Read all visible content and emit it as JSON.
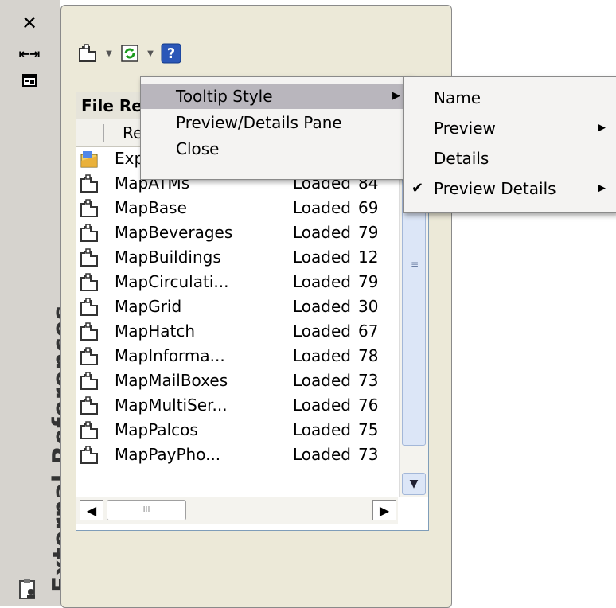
{
  "palette": {
    "title": "External References"
  },
  "file_references": {
    "group_header": "File Re",
    "column_header": "Re",
    "rows": [
      {
        "name": "Exp",
        "status": "",
        "size": ""
      },
      {
        "name": "MapATMs",
        "status": "Loaded",
        "size": "84"
      },
      {
        "name": "MapBase",
        "status": "Loaded",
        "size": "69"
      },
      {
        "name": "MapBeverages",
        "status": "Loaded",
        "size": "79"
      },
      {
        "name": "MapBuildings",
        "status": "Loaded",
        "size": "12"
      },
      {
        "name": "MapCirculati...",
        "status": "Loaded",
        "size": "79"
      },
      {
        "name": "MapGrid",
        "status": "Loaded",
        "size": "30"
      },
      {
        "name": "MapHatch",
        "status": "Loaded",
        "size": "67"
      },
      {
        "name": "MapInforma...",
        "status": "Loaded",
        "size": "78"
      },
      {
        "name": "MapMailBoxes",
        "status": "Loaded",
        "size": "73"
      },
      {
        "name": "MapMultiSer...",
        "status": "Loaded",
        "size": "76"
      },
      {
        "name": "MapPalcos",
        "status": "Loaded",
        "size": "75"
      },
      {
        "name": "MapPayPho...",
        "status": "Loaded",
        "size": "73"
      }
    ]
  },
  "context_menu": {
    "items": [
      {
        "label": "Tooltip Style",
        "has_submenu": true,
        "highlighted": true
      },
      {
        "label": "Preview/Details Pane",
        "has_submenu": false,
        "highlighted": false
      },
      {
        "label": "Close",
        "has_submenu": false,
        "highlighted": false
      }
    ]
  },
  "tooltip_submenu": {
    "items": [
      {
        "label": "Name",
        "checked": false,
        "has_submenu": false
      },
      {
        "label": "Preview",
        "checked": false,
        "has_submenu": true
      },
      {
        "label": "Details",
        "checked": false,
        "has_submenu": false
      },
      {
        "label": "Preview  Details",
        "checked": true,
        "has_submenu": true
      }
    ]
  },
  "colors": {
    "menu_highlight": "#b9b6bd",
    "title_strip": "#d6d3ce",
    "panel_background": "#ece9d8"
  }
}
